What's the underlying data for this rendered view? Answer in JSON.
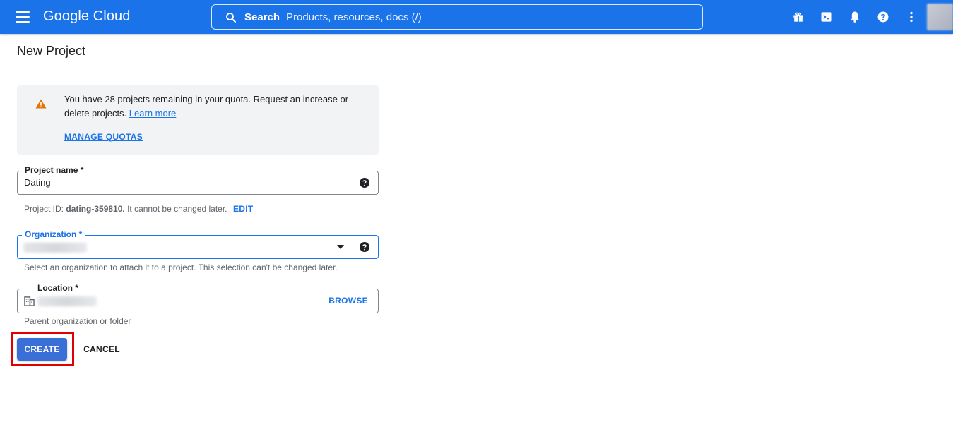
{
  "header": {
    "logo_text": "Google Cloud",
    "search_label": "Search",
    "search_placeholder": "Products, resources, docs (/)",
    "icons": [
      "menu-icon",
      "gift-icon",
      "cloud-shell-icon",
      "notifications-icon",
      "help-icon",
      "more-vert-icon"
    ]
  },
  "page": {
    "title": "New Project"
  },
  "quota_banner": {
    "message": "You have 28 projects remaining in your quota. Request an increase or delete projects.",
    "learn_more": "Learn more",
    "manage_quotas": "MANAGE QUOTAS",
    "icon": "warning-icon",
    "icon_color": "#e37400"
  },
  "form": {
    "project_name": {
      "label": "Project name *",
      "value": "Dating"
    },
    "project_id_hint": {
      "prefix": "Project ID: ",
      "id": "dating-359810.",
      "suffix": " It cannot be changed later.",
      "edit": "EDIT"
    },
    "organization": {
      "label": "Organization *",
      "hint": "Select an organization to attach it to a project. This selection can't be changed later."
    },
    "location": {
      "label": "Location *",
      "browse": "BROWSE",
      "hint": "Parent organization or folder"
    }
  },
  "actions": {
    "create": "CREATE",
    "cancel": "CANCEL"
  },
  "colors": {
    "brand_blue": "#1a73e8",
    "create_button": "#3b6fd8",
    "highlight_box": "#e00000"
  }
}
